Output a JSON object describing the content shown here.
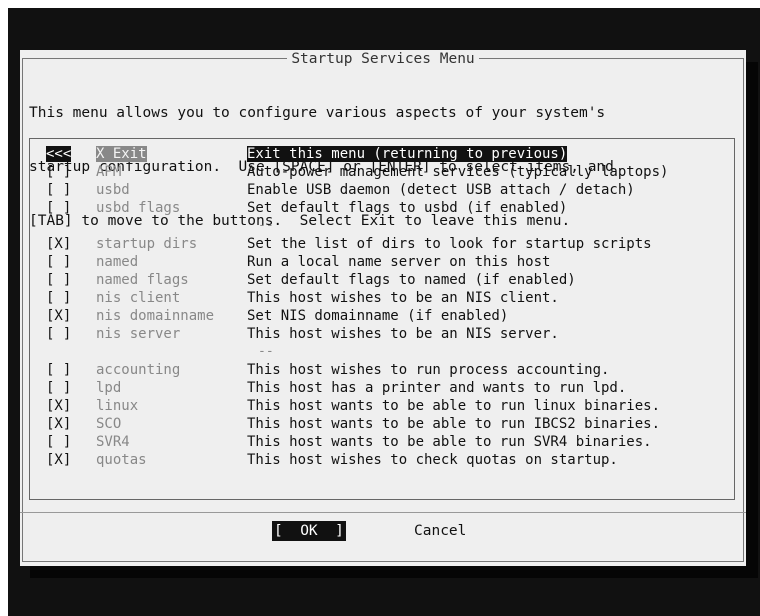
{
  "dialog": {
    "title": "Startup Services Menu",
    "description": [
      "This menu allows you to configure various aspects of your system's",
      "startup configuration.  Use [SPACE] or [ENTER] to select items, and",
      "[TAB] to move to the buttons.  Select Exit to leave this menu."
    ]
  },
  "items": [
    {
      "mark": "<<<",
      "name": "X Exit",
      "help": "Exit this menu (returning to previous)",
      "selected": true
    },
    {
      "mark": "[ ]",
      "name": "APM",
      "help": "Auto-power management services (typically laptops)"
    },
    {
      "mark": "[ ]",
      "name": "usbd",
      "help": "Enable USB daemon (detect USB attach / detach)"
    },
    {
      "mark": "[ ]",
      "name": "usbd flags",
      "help": "Set default flags to usbd (if enabled)"
    },
    {
      "separator": "--"
    },
    {
      "mark": "[X]",
      "name": "startup dirs",
      "help": "Set the list of dirs to look for startup scripts"
    },
    {
      "mark": "[ ]",
      "name": "named",
      "help": "Run a local name server on this host"
    },
    {
      "mark": "[ ]",
      "name": "named flags",
      "help": "Set default flags to named (if enabled)"
    },
    {
      "mark": "[ ]",
      "name": "nis client",
      "help": "This host wishes to be an NIS client."
    },
    {
      "mark": "[X]",
      "name": "nis domainname",
      "help": "Set NIS domainname (if enabled)"
    },
    {
      "mark": "[ ]",
      "name": "nis server",
      "help": "This host wishes to be an NIS server."
    },
    {
      "separator": "--"
    },
    {
      "mark": "[ ]",
      "name": "accounting",
      "help": "This host wishes to run process accounting."
    },
    {
      "mark": "[ ]",
      "name": "lpd",
      "help": "This host has a printer and wants to run lpd."
    },
    {
      "mark": "[X]",
      "name": "linux",
      "help": "This host wants to be able to run linux binaries."
    },
    {
      "mark": "[X]",
      "name": "SCO",
      "help": "This host wants to be able to run IBCS2 binaries."
    },
    {
      "mark": "[ ]",
      "name": "SVR4",
      "help": "This host wants to be able to run SVR4 binaries."
    },
    {
      "mark": "[X]",
      "name": "quotas",
      "help": "This host wishes to check quotas on startup."
    }
  ],
  "buttons": {
    "ok": "[  OK  ]",
    "cancel": "Cancel"
  },
  "colors": {
    "background": "#111111",
    "dialog": "#efefef",
    "highlight": "#111111",
    "dim_text": "#888888"
  }
}
